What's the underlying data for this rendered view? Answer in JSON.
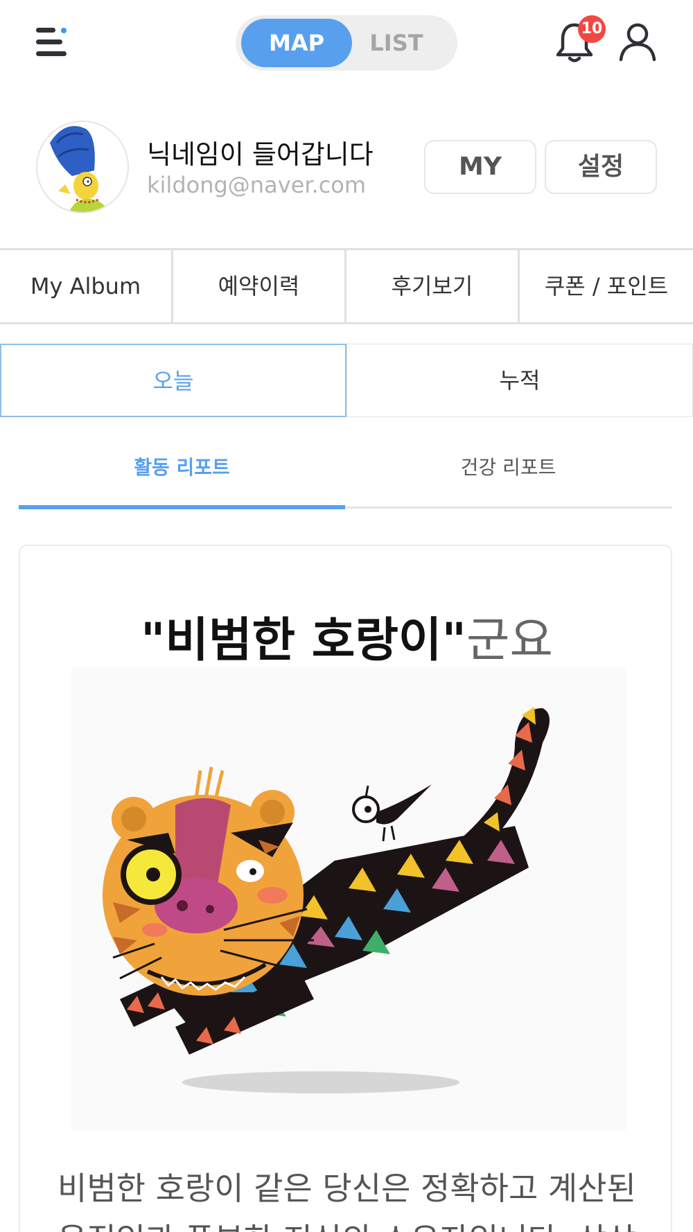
{
  "header": {
    "toggle": {
      "map_label": "MAP",
      "list_label": "LIST",
      "selected": "MAP"
    },
    "notifications": {
      "count": "10"
    },
    "colors": {
      "accent": "#58a0ee",
      "badge": "#f24844"
    }
  },
  "profile": {
    "nickname": "닉네임이 들어갑니다",
    "email": "kildong@naver.com",
    "my_button": "MY",
    "settings_button": "설정"
  },
  "quick_menu": {
    "items": [
      {
        "label": "My Album"
      },
      {
        "label": "예약이력"
      },
      {
        "label": "후기보기"
      },
      {
        "label": "쿠폰 / 포인트"
      }
    ]
  },
  "period_tabs": {
    "items": [
      {
        "label": "오늘",
        "active": true
      },
      {
        "label": "누적",
        "active": false
      }
    ]
  },
  "report_tabs": {
    "items": [
      {
        "label": "활동 리포트",
        "active": true
      },
      {
        "label": "건강 리포트",
        "active": false
      }
    ]
  },
  "result": {
    "title_strong": "\"비범한 호랑이\"",
    "title_suffix": "군요",
    "image_icon": "tiger-illustration",
    "description": "비범한 호랑이 같은 당신은 정확하고 계산된 움직임과 풍부한 지식의 소유자입니다. 상상"
  }
}
